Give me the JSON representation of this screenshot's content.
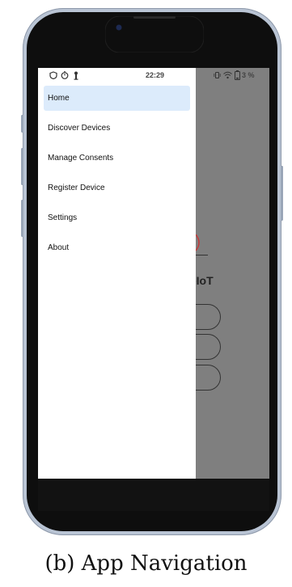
{
  "status_bar": {
    "time": "22:29",
    "battery": "3 %",
    "left_icons": [
      "shield-icon",
      "timer-icon",
      "key-icon"
    ],
    "right_icons": [
      "vibrate-icon",
      "wifi-icon",
      "battery-icon"
    ]
  },
  "drawer": {
    "items": [
      {
        "label": "Home",
        "active": true
      },
      {
        "label": "Discover Devices",
        "active": false
      },
      {
        "label": "Manage Consents",
        "active": false
      },
      {
        "label": "Register Device",
        "active": false
      },
      {
        "label": "Settings",
        "active": false
      },
      {
        "label": "About",
        "active": false
      }
    ]
  },
  "background": {
    "title_fragment": "-IoT"
  },
  "colors": {
    "drawer_active": "#dcebfb",
    "scrim": "#7f7f7f",
    "phone_frame": "#b9c4d4"
  },
  "caption": "(b) App Navigation"
}
